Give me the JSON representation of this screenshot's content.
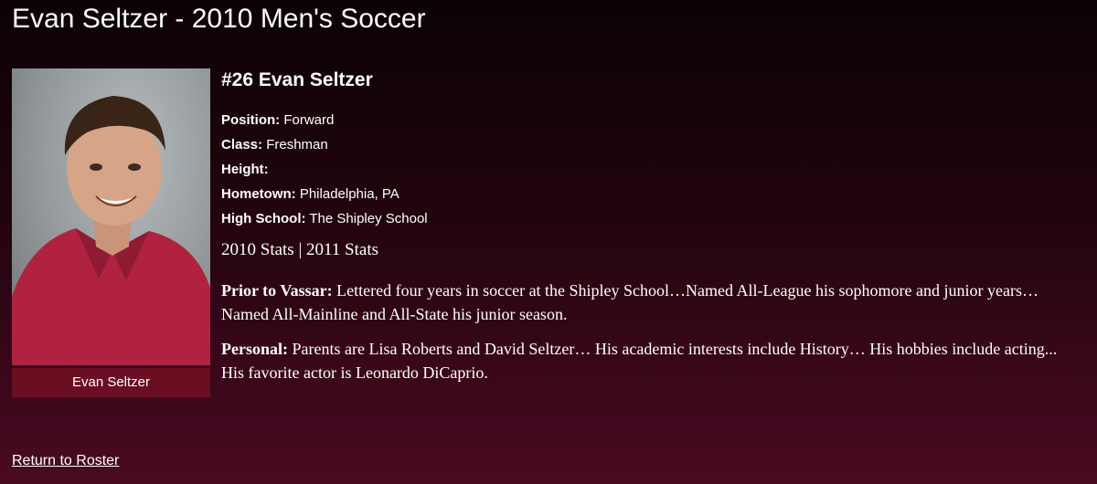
{
  "page": {
    "title": "Evan Seltzer - 2010 Men's Soccer"
  },
  "player": {
    "heading": "#26 Evan Seltzer",
    "photo_caption": "Evan Seltzer",
    "details": [
      {
        "label": "Position:",
        "value": " Forward"
      },
      {
        "label": "Class:",
        "value": " Freshman"
      },
      {
        "label": "Height:",
        "value": ""
      },
      {
        "label": "Hometown:",
        "value": " Philadelphia, PA"
      },
      {
        "label": "High School:",
        "value": " The Shipley School"
      }
    ],
    "stats": {
      "link_2010": "2010 Stats",
      "separator": " | ",
      "link_2011": "2011 Stats"
    },
    "prior": {
      "label": "Prior to Vassar:",
      "text": " Lettered four years in soccer at the Shipley School…Named All-League his sophomore and junior years… Named All-Mainline and All-State his junior season."
    },
    "personal": {
      "label": "Personal:",
      "text": " Parents are Lisa Roberts and David Seltzer… His academic interests include History… His hobbies include acting... His favorite actor is Leonardo DiCaprio."
    }
  },
  "footer": {
    "return_link": "Return to Roster"
  },
  "colors": {
    "caption_bg": "#6a0f22",
    "bg_top": "#0b0206",
    "bg_bottom": "#4a0a22"
  }
}
